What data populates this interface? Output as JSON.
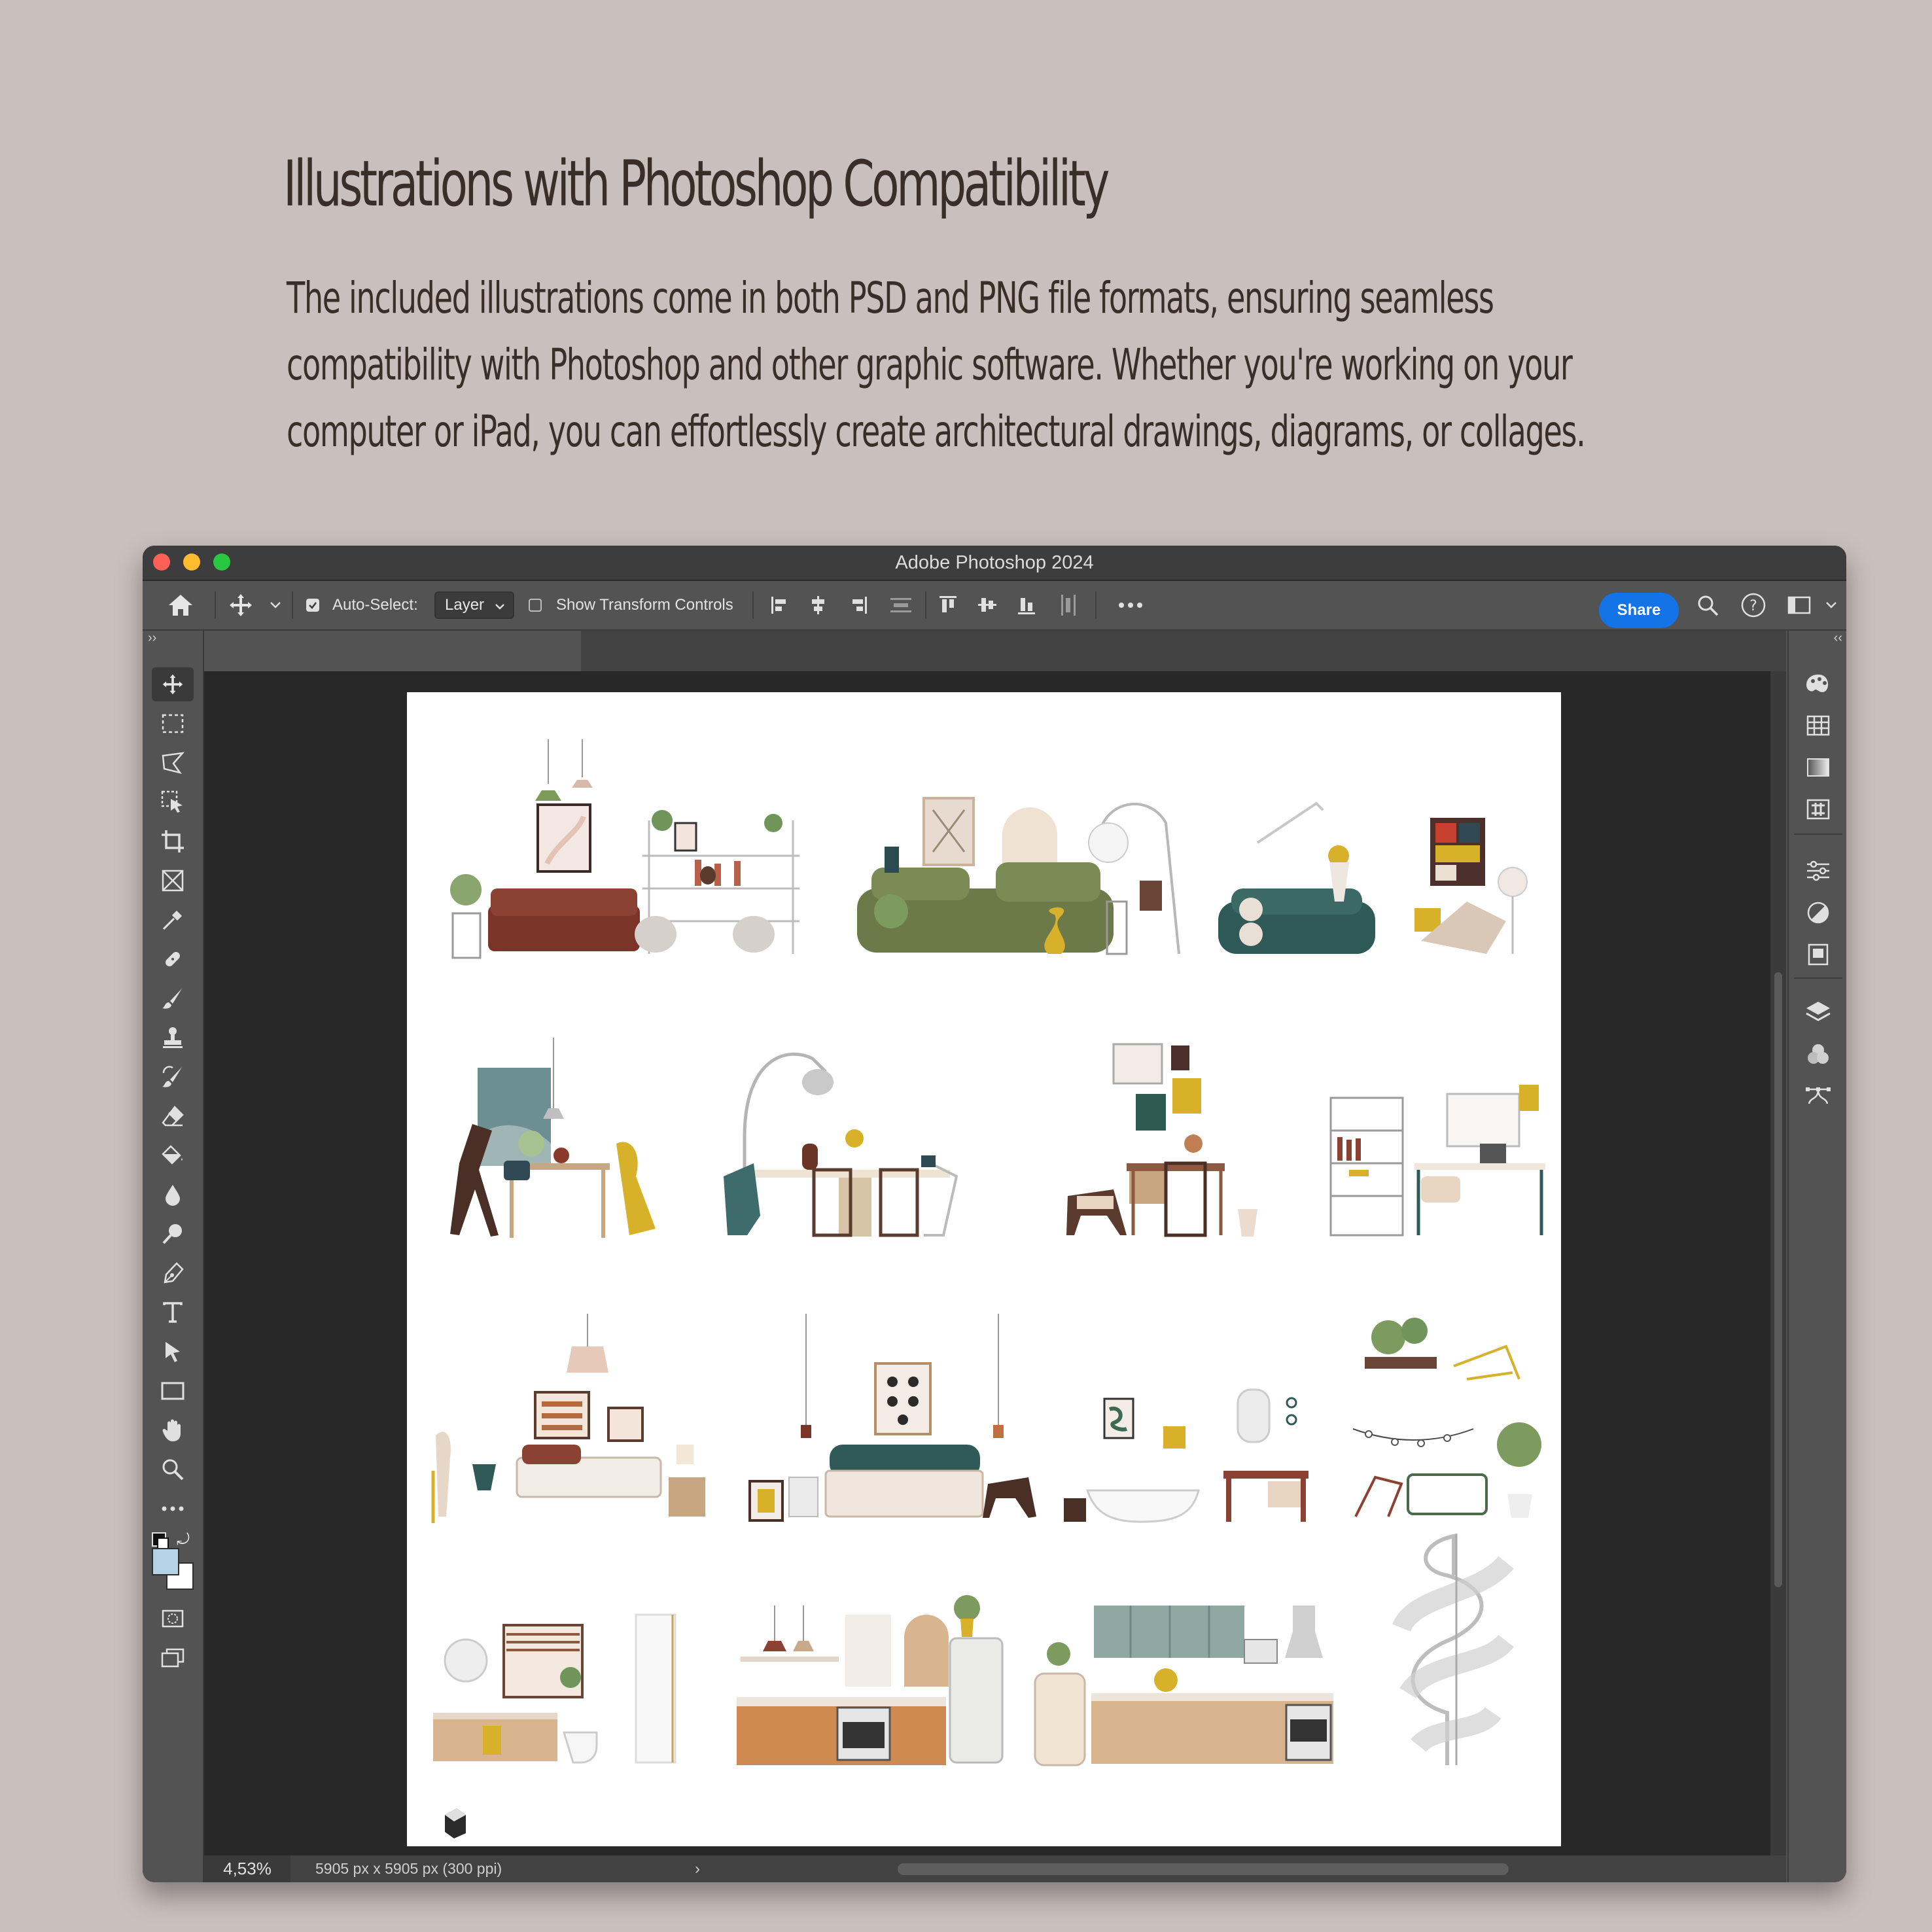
{
  "promo": {
    "title": "Illustrations with Photoshop Compatibility",
    "body_lines": [
      "The included illustrations come in both PSD and PNG file formats, ensuring seamless",
      "compatibility with Photoshop and other graphic software. Whether you're working on your",
      "computer or iPad, you can effortlessly create architectural drawings, diagrams, or collages."
    ]
  },
  "window": {
    "title": "Adobe Photoshop 2024"
  },
  "options_bar": {
    "auto_select_label": "Auto-Select:",
    "auto_select_checked": true,
    "layer_select_value": "Layer",
    "show_transform_label": "Show Transform Controls",
    "show_transform_checked": false,
    "share_label": "Share"
  },
  "tools": [
    "move-tool",
    "marquee-tool",
    "lasso-tool",
    "object-selection-tool",
    "crop-tool",
    "frame-tool",
    "eyedropper-tool",
    "healing-brush-tool",
    "brush-tool",
    "clone-stamp-tool",
    "history-brush-tool",
    "eraser-tool",
    "paint-bucket-tool",
    "blur-tool",
    "dodge-tool",
    "pen-tool",
    "type-tool",
    "path-selection-tool",
    "rectangle-tool",
    "hand-tool",
    "zoom-tool",
    "more-tools"
  ],
  "right_panel_icons": [
    "color-panel-icon",
    "swatches-icon",
    "gradients-icon",
    "patterns-icon",
    "adjustments-icon",
    "properties-icon",
    "libraries-icon",
    "layers-icon",
    "channels-icon",
    "paths-icon"
  ],
  "colors": {
    "foreground": "#b5d3e7",
    "background": "#ffffff",
    "share": "#1473e6"
  },
  "status": {
    "zoom": "4,53%",
    "doc_size": "5905 px x 5905 px (300 ppi)",
    "arrow": "›"
  }
}
